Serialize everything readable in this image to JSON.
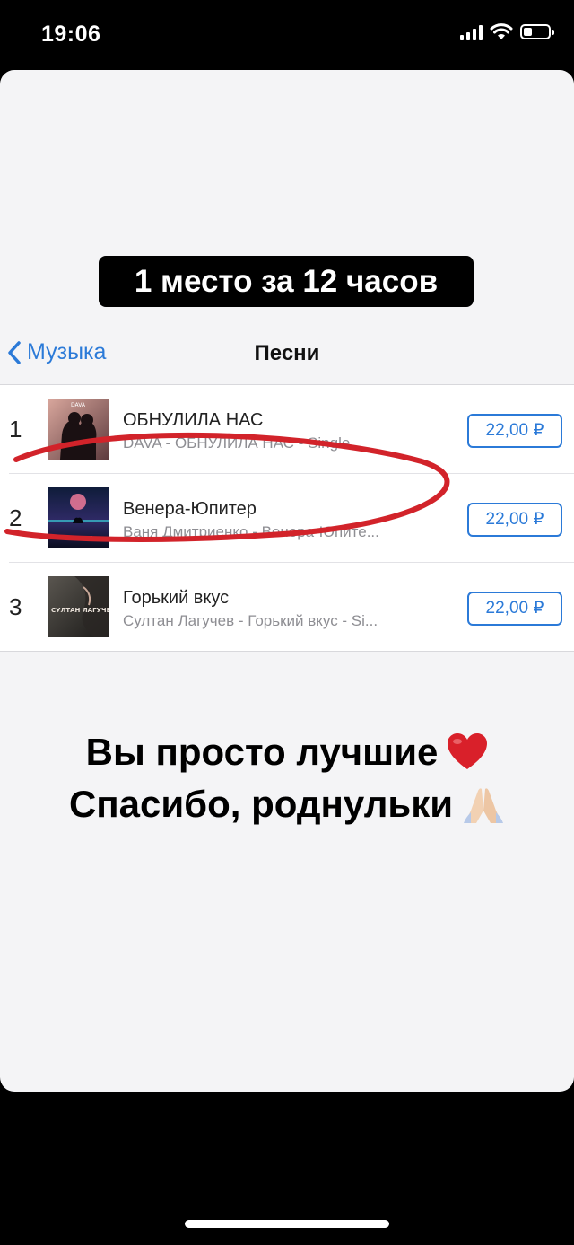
{
  "status_bar": {
    "time": "19:06"
  },
  "story_label": "1 место за 12 часов",
  "nav": {
    "back_label": "Музыка",
    "title": "Песни"
  },
  "songs": [
    {
      "rank": "1",
      "title": "ОБНУЛИЛА НАС",
      "subtitle": "DAVA - ОБНУЛИЛА НАС - Single",
      "price": "22,00 ₽",
      "cover_text": "DAVA"
    },
    {
      "rank": "2",
      "title": "Венера-Юпитер",
      "subtitle": "Ваня Дмитриенко - Венера-Юпите...",
      "price": "22,00 ₽"
    },
    {
      "rank": "3",
      "title": "Горький вкус",
      "subtitle": "Султан Лагучев - Горький вкус - Si...",
      "price": "22,00 ₽",
      "cover_text": "СУЛТАН ЛАГУЧЕВ"
    }
  ],
  "thanks": {
    "line1": "Вы просто лучшие",
    "line2": "Спасибо, роднульки"
  },
  "colors": {
    "accent": "#2b7ad8",
    "annotation": "#d2232a"
  }
}
